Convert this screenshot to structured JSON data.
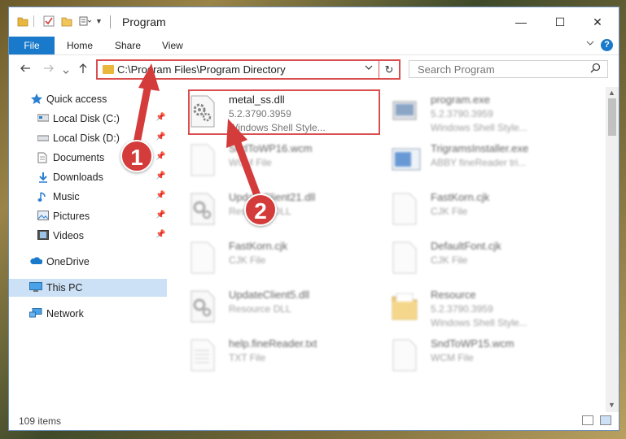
{
  "window": {
    "title": "Program",
    "controls": {
      "minimize": "—",
      "maximize": "☐",
      "close": "✕"
    }
  },
  "ribbon": {
    "tabs": [
      "File",
      "Home",
      "Share",
      "View"
    ],
    "expand_icon": "chevron-down-icon",
    "help": "?"
  },
  "address_bar": {
    "path": "C:\\Program Files\\Program Directory",
    "refresh_icon": "↻"
  },
  "search": {
    "placeholder": "Search Program"
  },
  "nav_pane": {
    "items": [
      {
        "label": "Quick access",
        "icon": "star-icon"
      },
      {
        "label": "Local Disk (C:)",
        "icon": "drive-icon",
        "pinned": true
      },
      {
        "label": "Local Disk (D:)",
        "icon": "drive-icon",
        "pinned": true
      },
      {
        "label": "Documents",
        "icon": "document-icon",
        "pinned": true
      },
      {
        "label": "Downloads",
        "icon": "download-icon",
        "pinned": true
      },
      {
        "label": "Music",
        "icon": "music-icon",
        "pinned": true
      },
      {
        "label": "Pictures",
        "icon": "picture-icon",
        "pinned": true
      },
      {
        "label": "Videos",
        "icon": "video-icon",
        "pinned": true
      },
      {
        "label": "OneDrive",
        "icon": "cloud-icon"
      },
      {
        "label": "This PC",
        "icon": "computer-icon",
        "selected": true
      },
      {
        "label": "Network",
        "icon": "network-icon"
      }
    ]
  },
  "files": [
    {
      "name": "metal_ss.dll",
      "line2": "5.2.3790.3959",
      "line3": "Windows Shell Style...",
      "icon": "dll-gear-icon",
      "highlighted": true
    },
    {
      "name": "program.exe",
      "line2": "5.2.3790.3959",
      "line3": "Windows Shell Style...",
      "icon": "exe-icon"
    },
    {
      "name": "SndToWP16.wcm",
      "line2": "WCM File",
      "line3": "",
      "icon": "file-icon"
    },
    {
      "name": "TrigramsInstaller.exe",
      "line2": "ABBY fineReader tri...",
      "line3": "",
      "icon": "installer-icon"
    },
    {
      "name": "UpdateClient21.dll",
      "line2": "Resource DLL",
      "line3": "",
      "icon": "dll-gear-icon"
    },
    {
      "name": "FastKorn.cjk",
      "line2": "CJK File",
      "line3": "",
      "icon": "file-icon"
    },
    {
      "name": "FastKorn.cjk",
      "line2": "CJK File",
      "line3": "",
      "icon": "file-icon"
    },
    {
      "name": "DefaultFont.cjk",
      "line2": "CJK File",
      "line3": "",
      "icon": "file-icon"
    },
    {
      "name": "UpdateClient5.dll",
      "line2": "Resource DLL",
      "line3": "",
      "icon": "dll-gear-icon"
    },
    {
      "name": "Resource",
      "line2": "5.2.3790.3959",
      "line3": "Windows Shell Style...",
      "icon": "folder-icon"
    },
    {
      "name": "help.fineReader.txt",
      "line2": "TXT File",
      "line3": "",
      "icon": "text-file-icon"
    },
    {
      "name": "SndToWP15.wcm",
      "line2": "WCM File",
      "line3": "",
      "icon": "file-icon"
    }
  ],
  "status": {
    "item_count": "109 items"
  },
  "annotations": {
    "badge1": "1",
    "badge2": "2",
    "color": "#d43b3b"
  }
}
